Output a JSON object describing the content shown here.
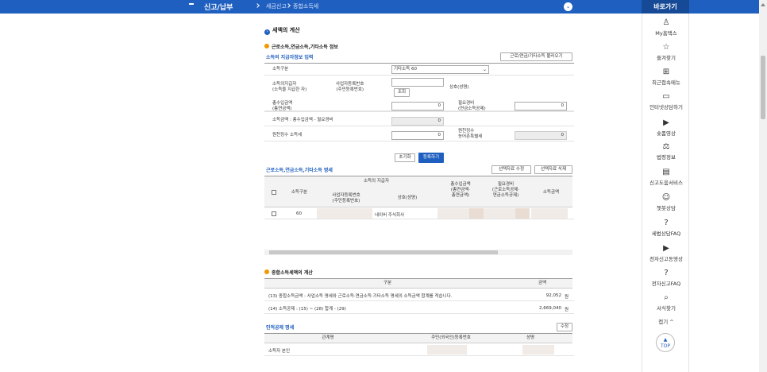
{
  "header": {
    "title": "신고/납부",
    "breadcrumb": [
      "세금신고",
      "종합소득세"
    ],
    "quick_title": "바로가기"
  },
  "sidebar": {
    "items": [
      {
        "icon": "user-icon",
        "glyph": "♙",
        "label": "My홈택스"
      },
      {
        "icon": "star-icon",
        "glyph": "☆",
        "label": "즐겨찾기"
      },
      {
        "icon": "menu-icon",
        "glyph": "⊞",
        "label": "최근접속메뉴"
      },
      {
        "icon": "monitor-icon",
        "glyph": "▭",
        "label": "인터넷상담하기"
      },
      {
        "icon": "play-icon",
        "glyph": "▶",
        "label": "숏폼영상"
      },
      {
        "icon": "gavel-icon",
        "glyph": "⚖",
        "label": "법령정보"
      },
      {
        "icon": "book-icon",
        "glyph": "▤",
        "label": "신고도움서비스"
      },
      {
        "icon": "chatbot-icon",
        "glyph": "☺",
        "label": "챗봇상담"
      },
      {
        "icon": "faq-icon",
        "glyph": "?",
        "label": "세법상담FAQ"
      },
      {
        "icon": "video-icon",
        "glyph": "▶",
        "label": "전자신고동영상"
      },
      {
        "icon": "faq2-icon",
        "glyph": "?",
        "label": "전자신고FAQ"
      },
      {
        "icon": "search-icon",
        "glyph": "⌕",
        "label": "서식찾기"
      }
    ],
    "collapse_label": "접기 ^",
    "top_label": "TOP"
  },
  "section1": {
    "title": "세액의 계산",
    "subtitle": "근로소득,연금소득,기타소득 정보",
    "payer_link": "소득의 지급자정보 입력",
    "load_button": "근로/연금/기타소득 불러오기",
    "income_type_label": "소득구분",
    "income_type_value": "기타소득 60",
    "payer_label": "소득의지급자\n(소득을 지급한 자)",
    "bizno_label": "사업자등록번호\n(주민등록번호)",
    "lookup_button": "조회",
    "company_label": "상호(성명)",
    "total_income_label": "총수입금액\n(총연금액)",
    "total_income_value": "0",
    "expense_label": "필요경비\n(연금소득공제)",
    "expense_value": "0",
    "income_amount_label": "소득금액 : 총수입금액 - 필요경비",
    "income_amount_value": "0",
    "withholding_label": "원천징수 소득세",
    "withholding_value": "0",
    "withholding_rural_label": "원천징수\n농어촌특별세",
    "withholding_rural_value": "0",
    "reset_button": "초기화",
    "register_button": "등록하기"
  },
  "detail": {
    "link": "근로소득,연금소득,기타소득 명세",
    "edit_button": "선택자료 수정",
    "delete_button": "선택자료 삭제",
    "headers": {
      "type": "소득구분",
      "payer_group": "소득의 지급자",
      "bizno": "사업자등록번호\n(주민등록번호)",
      "company": "상호(성명)",
      "total_income": "총수입금액\n(총연금액·\n총연금액)",
      "expense": "필요경비\n(근로소득공제·\n연금소득공제)",
      "income_amount": "소득금액"
    },
    "rows": [
      {
        "type": "60",
        "company": "네이버 주식회사"
      }
    ]
  },
  "section2": {
    "title": "종합소득세액의 계산",
    "col_item": "구분",
    "col_amount": "금액",
    "rows": [
      {
        "label": "(13) 종합소득금액 : 사업소득 명세와 근로소득·연금소득·기타소득 명세의 소득금액 합계를 적습니다.",
        "value": "92,052",
        "unit": "원"
      },
      {
        "label": "(14) 소득공제 : (15) ~ (28) 합계 - (29)",
        "value": "2,669,040",
        "unit": "원"
      }
    ]
  },
  "deduction": {
    "link": "인적공제 명세",
    "edit_button": "수정",
    "col_relation": "관계명",
    "col_id": "주민(외국인)등록번호",
    "col_name": "성명",
    "rows": [
      {
        "relation": "소득자 본인"
      }
    ]
  }
}
